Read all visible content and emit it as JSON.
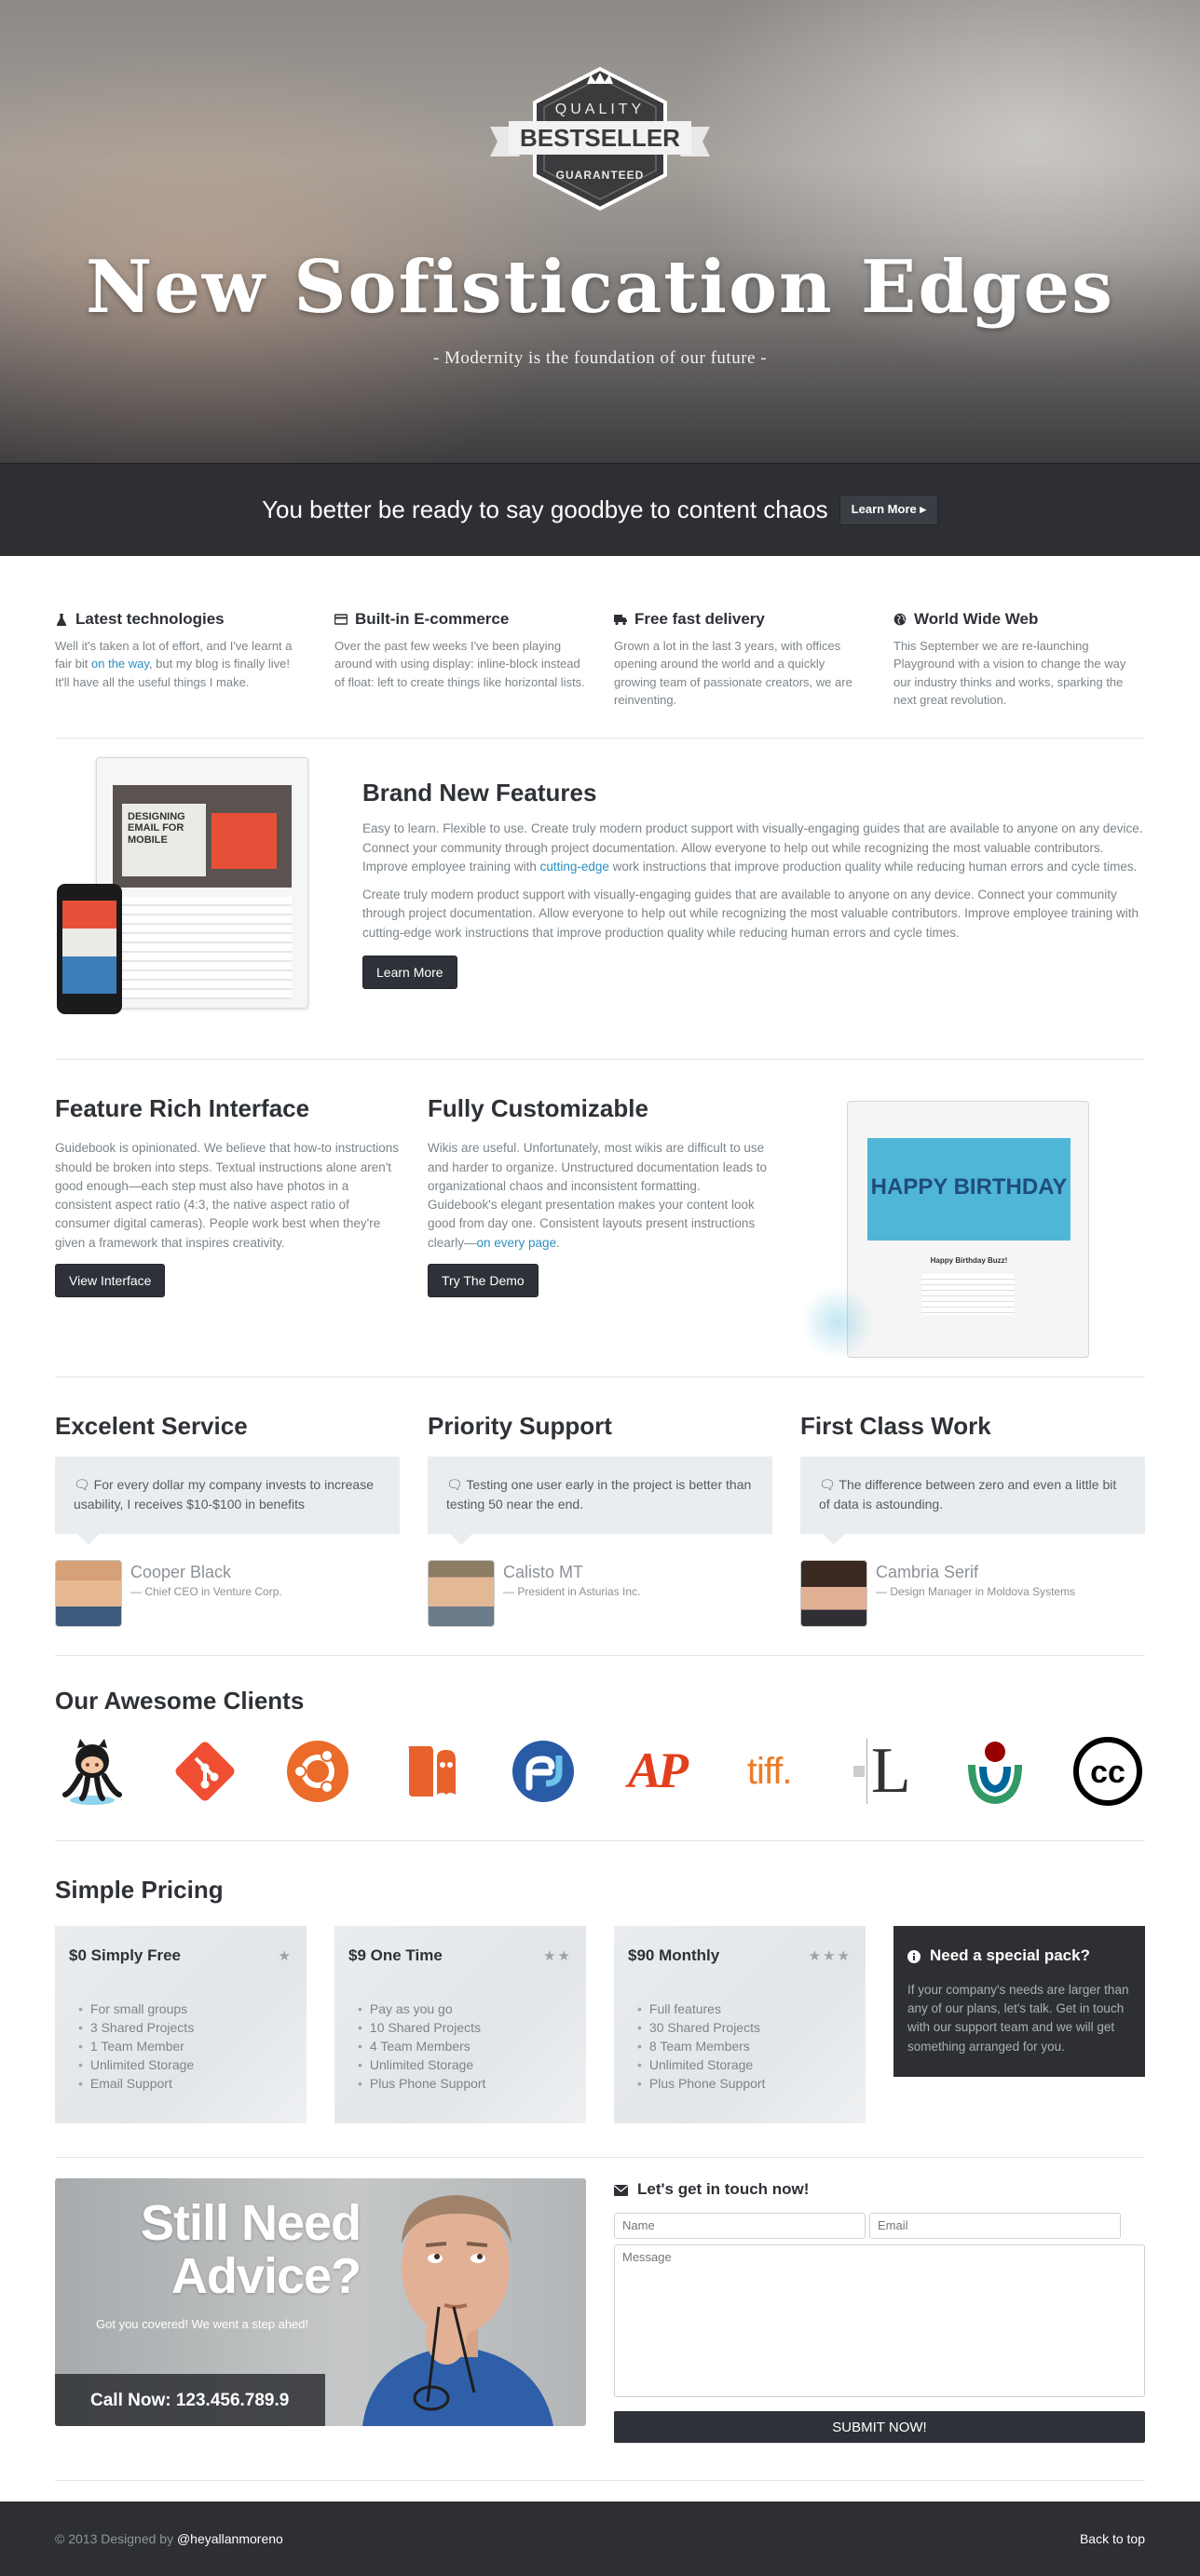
{
  "hero": {
    "badge": {
      "top": "QUALITY",
      "main": "BESTSELLER",
      "bottom": "GUARANTEED"
    },
    "title": "New Sofistication Edges",
    "tagline": "- Modernity is the foundation of our future -"
  },
  "cta": {
    "message": "You better be ready to say goodbye to content chaos",
    "button": "Learn More"
  },
  "features": [
    {
      "icon": "flask-icon",
      "title": "Latest technologies",
      "pre": "Well it's taken a lot of effort, and I've learnt a fair bit ",
      "link": "on the way",
      "post": ", but my blog is finally live! It'll have all the useful things I make."
    },
    {
      "icon": "credit-card-icon",
      "title": "Built-in E-commerce",
      "text": "Over the past few weeks I've been playing around with using display: inline-block instead of float: left to create things like horizontal lists."
    },
    {
      "icon": "truck-icon",
      "title": "Free fast delivery",
      "text": "Grown a lot in the last 3 years, with offices opening around the world and a quickly growing team of passionate creators, we are reinventing."
    },
    {
      "icon": "globe-icon",
      "title": "World Wide Web",
      "text": "This September we are re-launching Playground with a vision to change the way our industry thinks and works, sparking the next great revolution."
    }
  ],
  "brand": {
    "title": "Brand New Features",
    "p1_pre": "Easy to learn. Flexible to use. Create truly modern product support with visually-engaging guides that are available to anyone on any device. Connect your community through project documentation. Allow everyone to help out while recognizing the most valuable contributors. Improve employee training with ",
    "p1_link": "cutting-edge",
    "p1_post": " work instructions that improve production quality while reducing human errors and cycle times.",
    "p2": "Create truly modern product support with visually-engaging guides that are available to anyone on any device. Connect your community through project documentation. Allow everyone to help out while recognizing the most valuable contributors. Improve employee training with cutting-edge work instructions that improve production quality while reducing human errors and cycle times.",
    "button": "Learn More",
    "mock": {
      "heading1": "DESIGNING",
      "heading2": "EMAIL FOR",
      "heading3": "MOBILE"
    }
  },
  "feature_rich": {
    "title": "Feature Rich Interface",
    "text": "Guidebook is opinionated. We believe that how-to instructions should be broken into steps. Textual instructions alone aren't good enough—each step must also have photos in a consistent aspect ratio (4:3, the native aspect ratio of consumer digital cameras). People work best when they're given a framework that inspires creativity.",
    "button": "View Interface"
  },
  "customizable": {
    "title": "Fully Customizable",
    "text": "Wikis are useful. Unfortunately, most wikis are difficult to use and harder to organize. Unstructured documentation leads to organizational chaos and inconsistent formatting. Guidebook's elegant presentation makes your content look good from day one. Consistent layouts present instructions clearly—",
    "link": "on every page",
    "post": ".",
    "button": "Try The Demo",
    "mock": {
      "banner": "HAPPY BIRTHDAY",
      "subtitle": "Happy Birthday Buzz!"
    }
  },
  "testimonials": [
    {
      "title": "Excelent Service",
      "quote": "For every dollar my company invests to increase usability, I receives $10-$100 in benefits",
      "name": "Cooper Black",
      "role": "— Chief CEO in Venture Corp."
    },
    {
      "title": "Priority Support",
      "quote": "Testing one user early in the project is better than testing 50 near the end.",
      "name": "Calisto MT",
      "role": "— President in Asturias Inc."
    },
    {
      "title": "First Class Work",
      "quote": "The difference between zero and even a little bit of data is astounding.",
      "name": "Cambria Serif",
      "role": "— Design Manager in Moldova Systems"
    }
  ],
  "clients": {
    "title": "Our Awesome Clients",
    "logos": [
      "github-octocat-logo",
      "git-logo",
      "ubuntu-logo",
      "blogger-logo",
      "fedora-logo",
      "ap-logo",
      "tiff-logo",
      "typography-L-logo",
      "wikimedia-logo",
      "creative-commons-logo"
    ],
    "ap_text": "AP",
    "tiff_text": "tiff.",
    "cc_text": "cc",
    "l_text": "L"
  },
  "pricing": {
    "title": "Simple Pricing",
    "plans": [
      {
        "name": "$0 Simply Free",
        "stars": "★",
        "items": [
          "For small groups",
          "3 Shared Projects",
          "1 Team Member",
          "Unlimited Storage",
          "Email Support"
        ]
      },
      {
        "name": "$9 One Time",
        "stars": "★★",
        "items": [
          "Pay as you go",
          "10 Shared Projects",
          "4 Team Members",
          "Unlimited Storage",
          "Plus Phone Support"
        ]
      },
      {
        "name": "$90 Monthly",
        "stars": "★★★",
        "items": [
          "Full features",
          "30 Shared Projects",
          "8 Team Members",
          "Unlimited Storage",
          "Plus Phone Support"
        ]
      }
    ],
    "special": {
      "title": "Need a special pack?",
      "text": "If your company's needs are larger than any of our plans, let's talk. Get in touch with our support team and we will get something arranged for you."
    }
  },
  "advice": {
    "line1": "Still Need",
    "line2": "Advice?",
    "sub": "Got you covered! We went a step ahed!",
    "call": "Call Now: 123.456.789.9"
  },
  "contact": {
    "title": "Let's get in touch now!",
    "name_ph": "Name",
    "email_ph": "Email",
    "message_ph": "Message",
    "submit": "SUBMIT NOW!"
  },
  "footer": {
    "copy": "© 2013 Designed by ",
    "handle": "@heyallanmoreno",
    "back": "Back to top"
  },
  "colors": {
    "dark": "#2d2f33",
    "link": "#2a8fc0",
    "heading": "#2e3237",
    "muted": "#7d8489"
  }
}
